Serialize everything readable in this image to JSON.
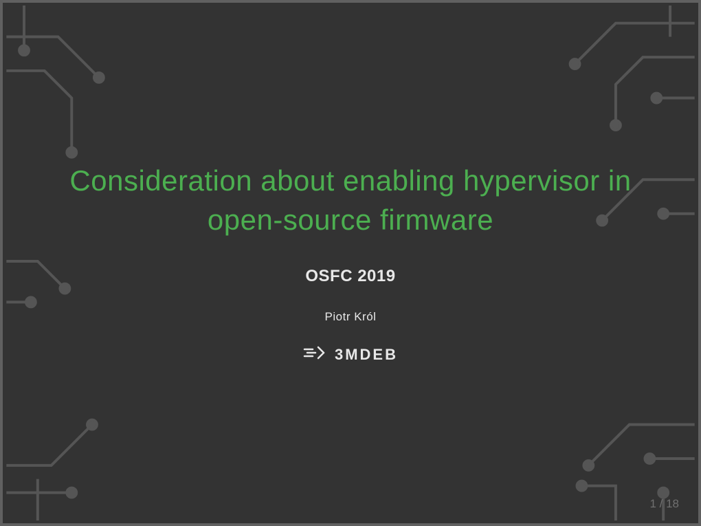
{
  "title": "Consideration about enabling hypervisor in open-source firmware",
  "subtitle": "OSFC 2019",
  "author": "Piotr Król",
  "logo_text": "3MDEB",
  "page_current": "1",
  "page_total": "18",
  "page_separator": " / ",
  "colors": {
    "accent": "#4caf50",
    "background": "#333333",
    "text": "#e8e8e8",
    "border": "#606060",
    "muted": "#707070"
  }
}
